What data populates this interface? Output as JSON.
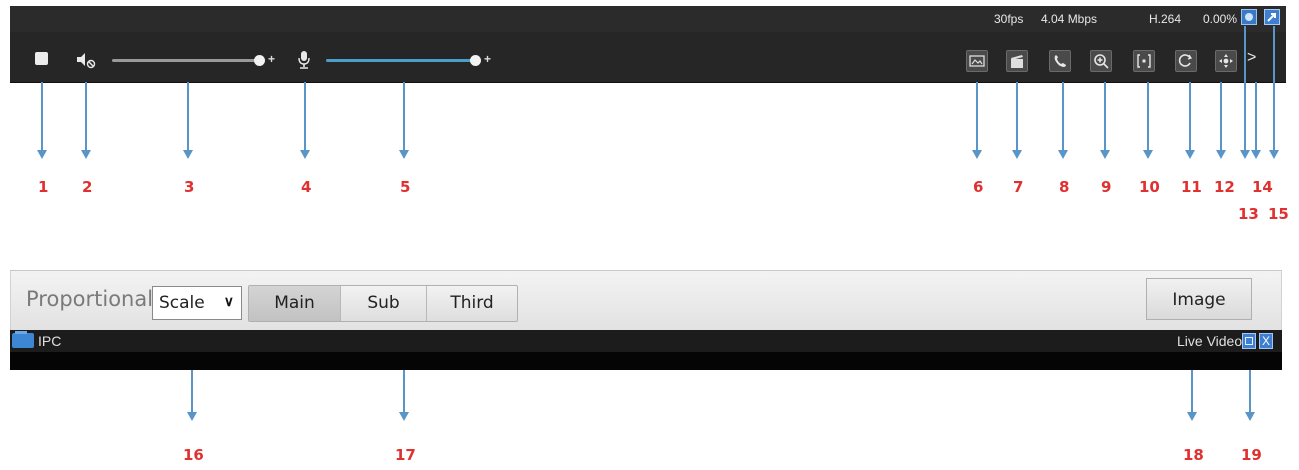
{
  "status": {
    "fps": "30fps",
    "bitrate": "4.04 Mbps",
    "codec": "H.264",
    "loss": "0.00%"
  },
  "toolbar": {
    "stop_icon": "stop-square",
    "mute_icon": "speaker-muted",
    "volume_level": 1.0,
    "mic_icon": "microphone",
    "mic_level": 1.0,
    "plus": "+",
    "next_arrow": ">"
  },
  "callouts": [
    "1",
    "2",
    "3",
    "4",
    "5",
    "6",
    "7",
    "8",
    "9",
    "10",
    "11",
    "12",
    "13",
    "14",
    "15",
    "16",
    "17",
    "18",
    "19"
  ],
  "panel": {
    "proportional_label": "Proportional :",
    "scale_value": "Scale",
    "tabs": [
      "Main",
      "Sub",
      "Third"
    ],
    "image_button": "Image"
  },
  "video": {
    "ipc_label": "IPC",
    "live_label": "Live Video",
    "close_glyph": "X"
  },
  "colors": {
    "arrow": "#5a95c8",
    "callout_number": "#e03030",
    "mic_track": "#4a9fc8"
  }
}
